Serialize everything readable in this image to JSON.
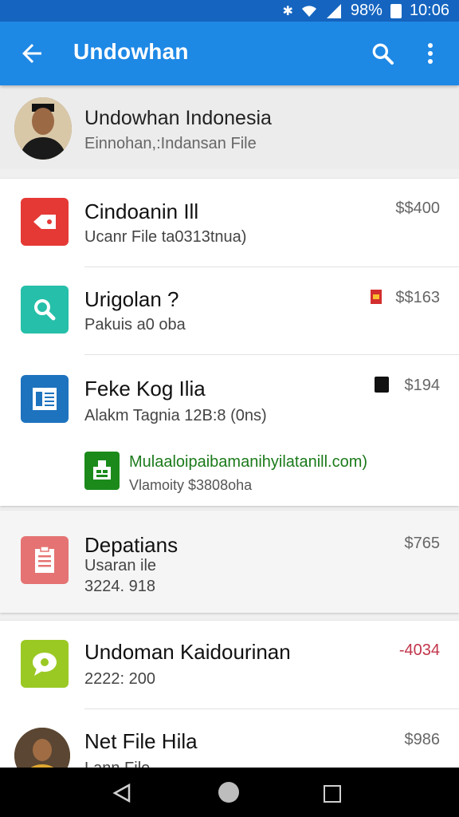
{
  "status_bar": {
    "battery": "98%",
    "time": "10:06",
    "icons": [
      "bluetooth-icon",
      "wifi-icon",
      "signal-icon",
      "battery-icon"
    ]
  },
  "app_bar": {
    "title": "Undowhan",
    "icons": [
      "back-arrow-icon",
      "search-icon",
      "more-vert-icon"
    ]
  },
  "profile": {
    "name": "Undowhan Indonesia",
    "subtitle": "Einnohan,:Indansan File"
  },
  "items": [
    {
      "title": "Cindoanin Ill",
      "subtitle": "Ucanr File ta0313tnua)",
      "price": "$$400",
      "icon": "tag-icon",
      "icon_color": "#e53935"
    },
    {
      "title": "Urigolan ?",
      "subtitle": "Pakuis a0 oba",
      "price": "$$163",
      "icon": "search-icon",
      "icon_color": "#26bfa9"
    },
    {
      "title": "Feke Kog Ilia",
      "subtitle": "Alakm Tagnia 12B:8 (0ns)",
      "price": "$194",
      "icon": "document-icon",
      "icon_color": "#1e73be",
      "sub_link": "Mulaaloipaibamanihyilatanill.com)",
      "sub_desc": "Vlamoity $3808oha",
      "sub_icon": "app-store-icon"
    },
    {
      "title": "Depatians",
      "subtitle": "Usaran ile",
      "subtitle2": "3224. 918",
      "price": "$765",
      "icon": "clipboard-icon",
      "icon_color": "#e57373"
    },
    {
      "title": "Undoman Kaidourinan",
      "subtitle": "2222: 200",
      "price": "-4034",
      "icon": "chat-bubble-icon",
      "icon_color": "#9bc924"
    },
    {
      "title": "Net File Hila",
      "subtitle": "Lann File",
      "price": "$986",
      "icon": "avatar"
    }
  ],
  "nav": {
    "icons": [
      "back-triangle-icon",
      "home-circle-icon",
      "recents-square-icon"
    ]
  }
}
